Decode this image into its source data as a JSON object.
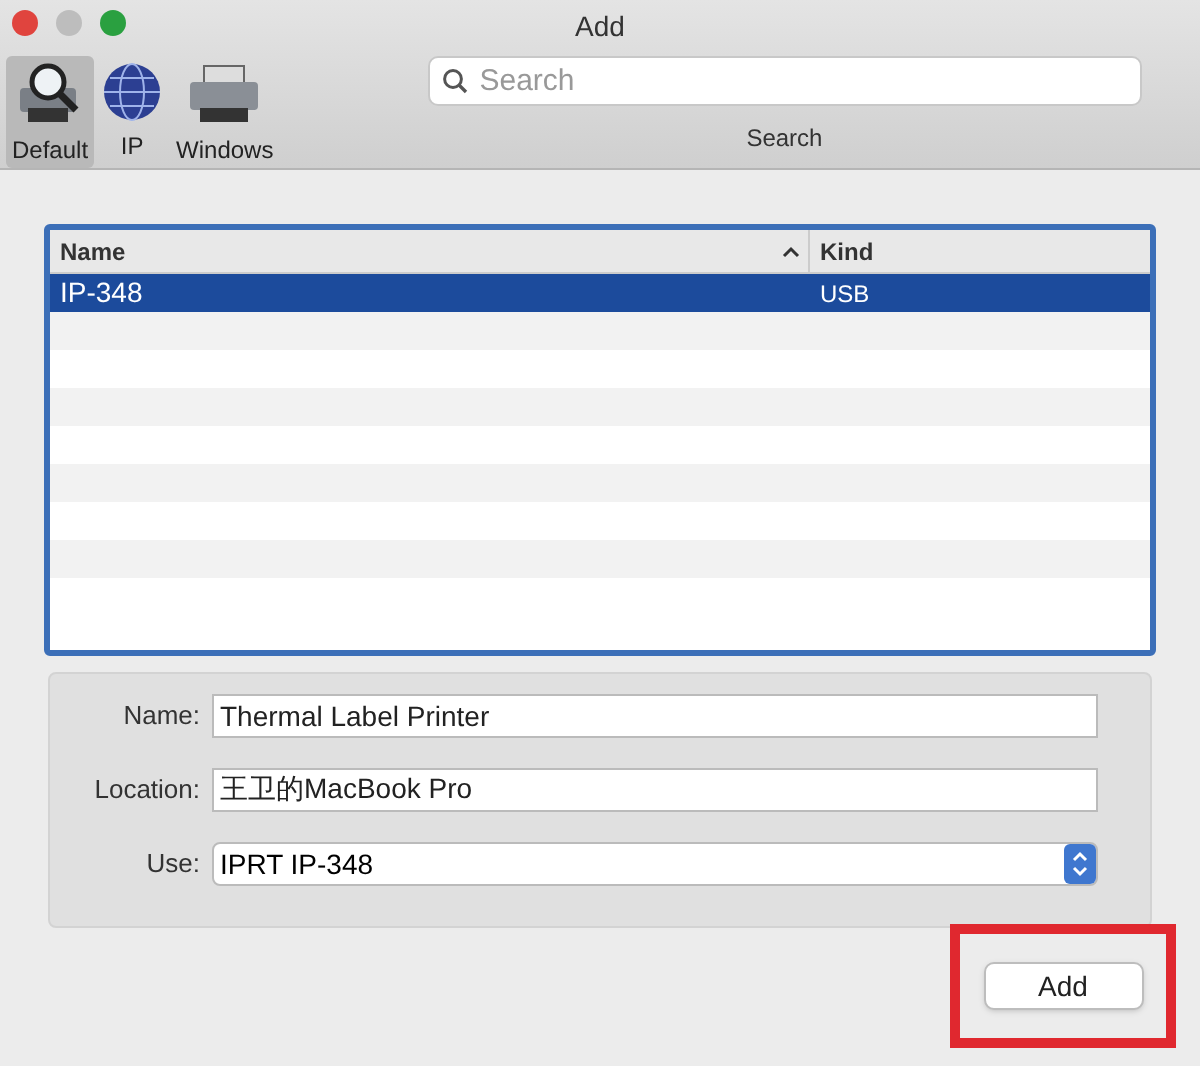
{
  "window": {
    "title": "Add"
  },
  "toolbar": {
    "tabs": [
      {
        "label": "Default",
        "kind": "default",
        "selected": true
      },
      {
        "label": "IP",
        "kind": "ip",
        "selected": false
      },
      {
        "label": "Windows",
        "kind": "windows",
        "selected": false
      }
    ],
    "search": {
      "placeholder": "Search",
      "label": "Search"
    }
  },
  "table": {
    "columns": [
      "Name",
      "Kind"
    ],
    "rows": [
      {
        "cells": [
          "IP-348",
          "USB"
        ],
        "selected": true
      }
    ]
  },
  "form": [
    {
      "label": "Name:",
      "value": "Thermal Label Printer",
      "kind": "text"
    },
    {
      "label": "Location:",
      "value": "王卫的MacBook Pro",
      "kind": "text"
    },
    {
      "label": "Use:",
      "value": "IPRT IP-348",
      "kind": "select"
    }
  ],
  "buttons": [
    "Add"
  ]
}
